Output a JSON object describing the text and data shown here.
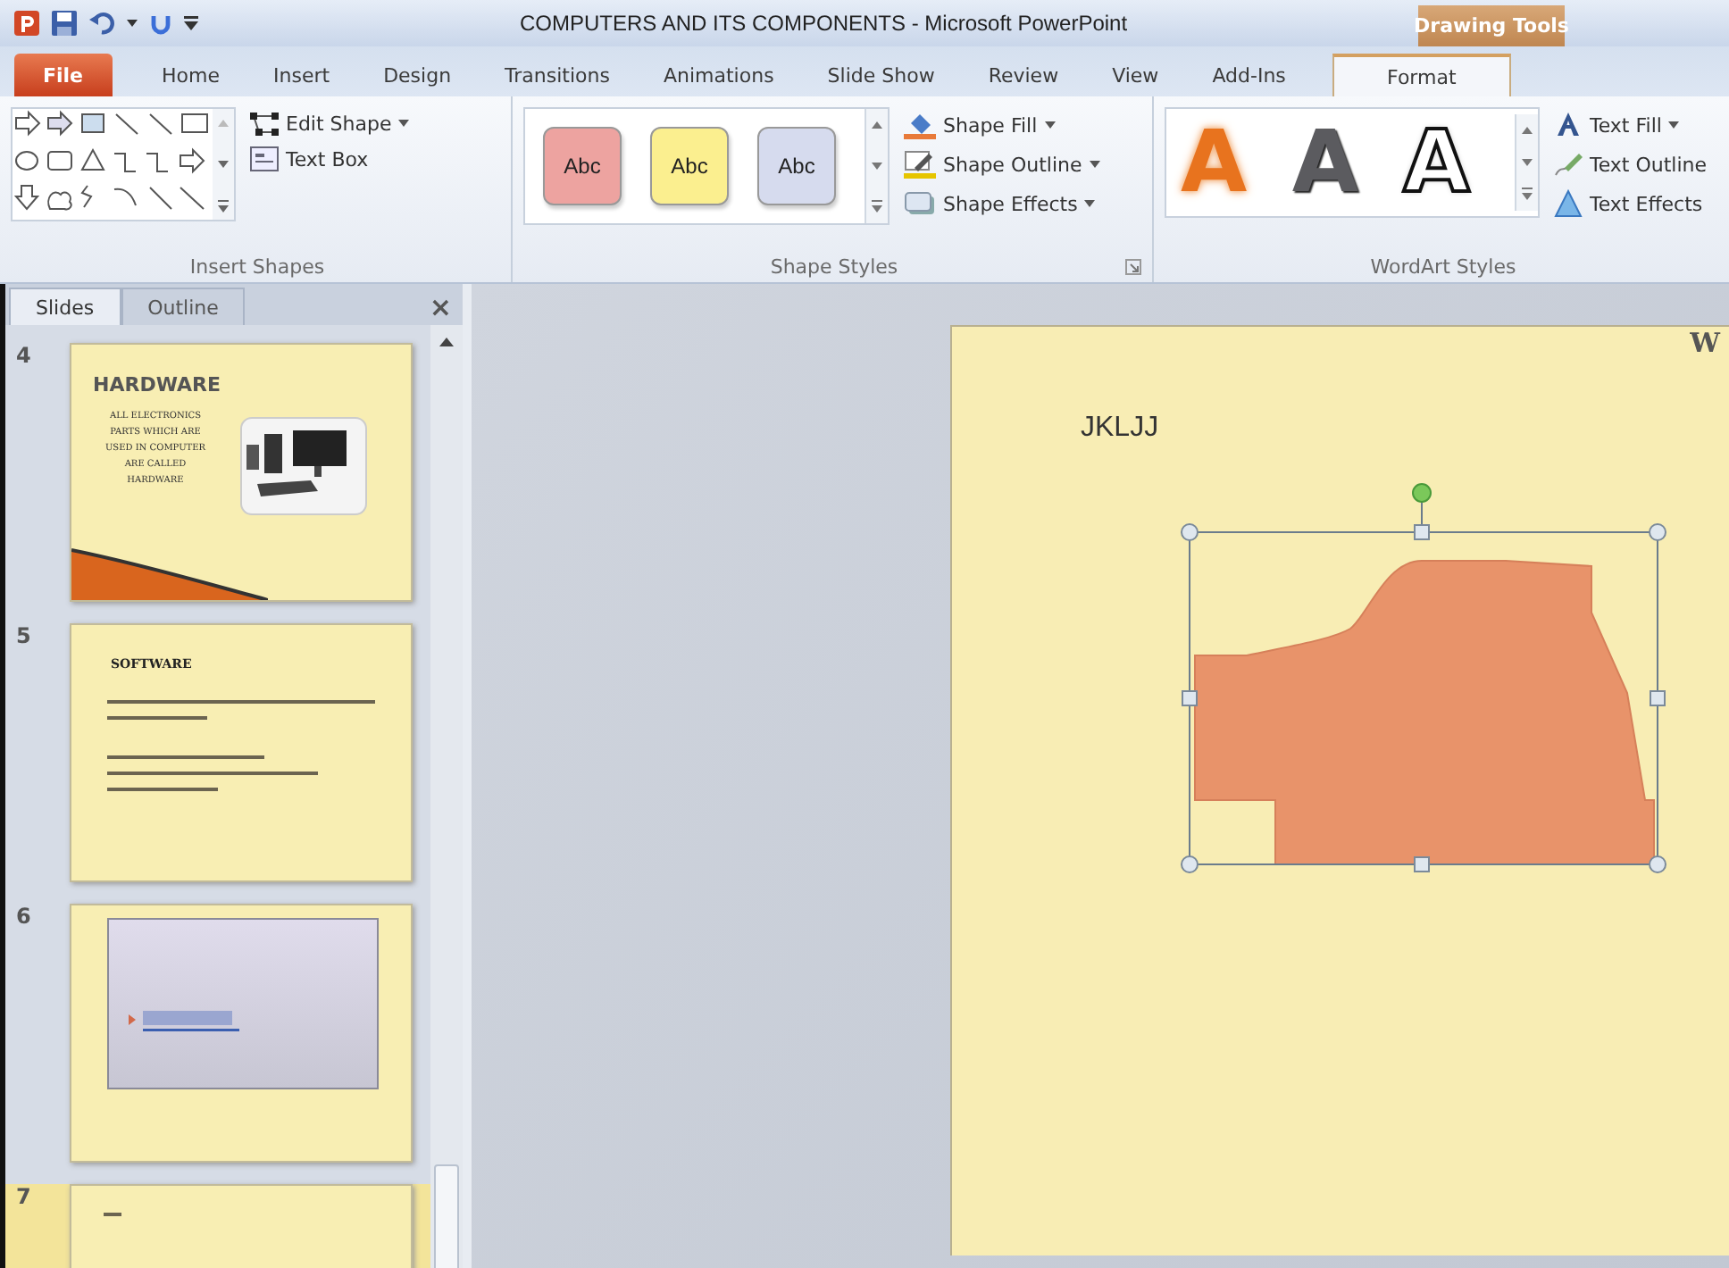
{
  "window": {
    "title": "COMPUTERS AND ITS COMPONENTS - Microsoft PowerPoint",
    "context_tab": "Drawing Tools"
  },
  "tabs": [
    {
      "label": "File",
      "kind": "file",
      "selected": false
    },
    {
      "label": "Home",
      "kind": "tab",
      "selected": false
    },
    {
      "label": "Insert",
      "kind": "tab",
      "selected": false
    },
    {
      "label": "Design",
      "kind": "tab",
      "selected": false
    },
    {
      "label": "Transitions",
      "kind": "tab",
      "selected": false
    },
    {
      "label": "Animations",
      "kind": "tab",
      "selected": false
    },
    {
      "label": "Slide Show",
      "kind": "tab",
      "selected": false
    },
    {
      "label": "Review",
      "kind": "tab",
      "selected": false
    },
    {
      "label": "View",
      "kind": "tab",
      "selected": false
    },
    {
      "label": "Add-Ins",
      "kind": "tab",
      "selected": false
    },
    {
      "label": "Format",
      "kind": "context",
      "selected": true
    }
  ],
  "insert_shapes": {
    "label": "Insert Shapes",
    "commands": [
      {
        "label": "Edit Shape",
        "kind": "edit",
        "dropdown": true
      },
      {
        "label": "Text Box",
        "kind": "textbox",
        "dropdown": false
      }
    ]
  },
  "shape_styles": {
    "label": "Shape Styles",
    "presets": [
      {
        "label": "Abc",
        "color": "#eda3a0"
      },
      {
        "label": "Abc",
        "color": "#fbef8f"
      },
      {
        "label": "Abc",
        "color": "#d6dbee"
      }
    ],
    "commands": [
      {
        "label": "Shape Fill",
        "kind": "fill",
        "dropdown": true
      },
      {
        "label": "Shape Outline",
        "kind": "outline",
        "dropdown": true
      },
      {
        "label": "Shape Effects",
        "kind": "effects",
        "dropdown": true
      }
    ]
  },
  "wordart_styles": {
    "label": "WordArt Styles",
    "presets": [
      {
        "label": "A",
        "kind": "glow",
        "color": "#e8731e"
      },
      {
        "label": "A",
        "kind": "solid",
        "color": "#5b5b5f"
      },
      {
        "label": "A",
        "kind": "outline",
        "color": "#ffffff"
      }
    ],
    "commands": [
      {
        "label": "Text Fill",
        "kind": "fill",
        "dropdown": true
      },
      {
        "label": "Text Outline",
        "kind": "outline",
        "dropdown": false
      },
      {
        "label": "Text Effects",
        "kind": "effects",
        "dropdown": false
      }
    ]
  },
  "slides_pane": {
    "tabs": [
      {
        "label": "Slides",
        "selected": true
      },
      {
        "label": "Outline",
        "selected": false
      }
    ],
    "close": "×",
    "thumbnails": [
      {
        "number": "4",
        "kind": "picture_text",
        "title": "HARDWARE",
        "body": "ALL ELECTRONICS PARTS WHICH ARE USED IN COMPUTER ARE CALLED HARDWARE",
        "selected": false
      },
      {
        "number": "5",
        "kind": "bullets",
        "title": "SOFTWARE",
        "selected": false
      },
      {
        "number": "6",
        "kind": "framed",
        "selected": false
      },
      {
        "number": "7",
        "kind": "partial",
        "selected": true
      }
    ]
  },
  "slide": {
    "title": "JKLJJ",
    "corner_text": "W"
  }
}
